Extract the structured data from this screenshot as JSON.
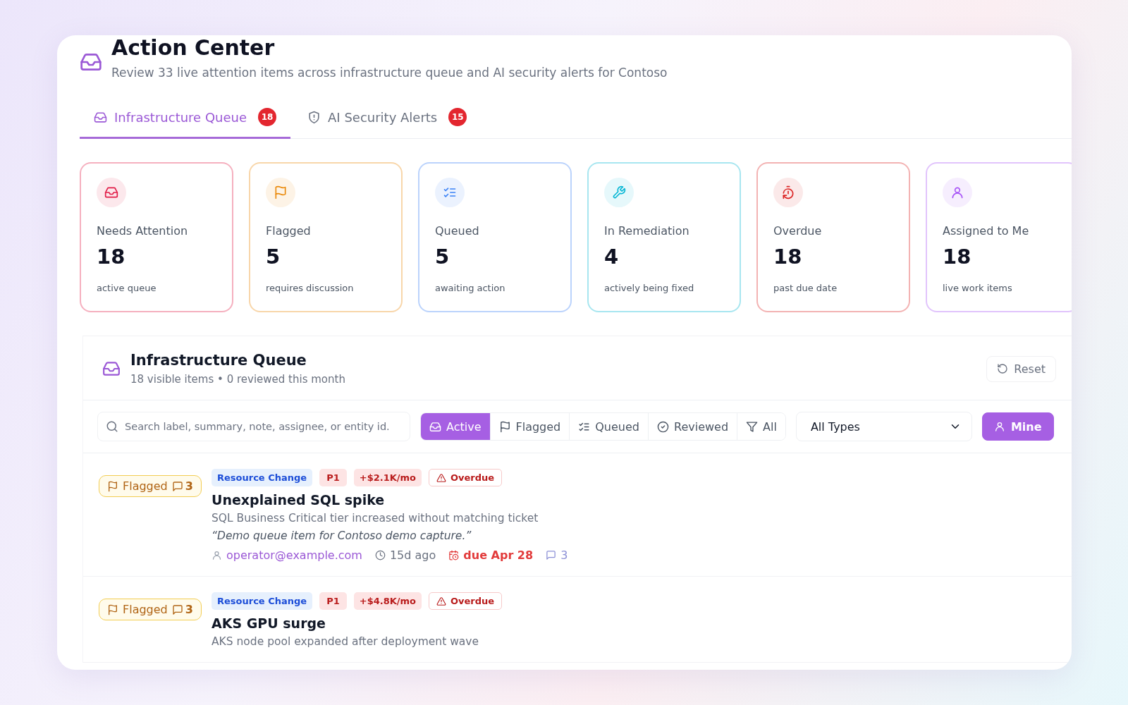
{
  "header": {
    "title": "Action Center",
    "subtitle": "Review 33 live attention items across infrastructure queue and AI security alerts for Contoso"
  },
  "tabs": [
    {
      "kind": "inbox",
      "label": "Infrastructure Queue",
      "count": "18",
      "selected": true
    },
    {
      "kind": "shield",
      "label": "AI Security Alerts",
      "count": "15",
      "selected": false
    }
  ],
  "stats": [
    {
      "kind": "inbox",
      "label": "Needs Attention",
      "value": "18",
      "note": "active queue",
      "color": "#e11d48"
    },
    {
      "kind": "flag",
      "label": "Flagged",
      "value": "5",
      "note": "requires discussion",
      "color": "#ea8a0c"
    },
    {
      "kind": "checklist",
      "label": "Queued",
      "value": "5",
      "note": "awaiting action",
      "color": "#3b82f6"
    },
    {
      "kind": "wrench",
      "label": "In Remediation",
      "value": "4",
      "note": "actively being fixed",
      "color": "#06b6d4"
    },
    {
      "kind": "timer",
      "label": "Overdue",
      "value": "18",
      "note": "past due date",
      "color": "#dc2626"
    },
    {
      "kind": "user",
      "label": "Assigned to Me",
      "value": "18",
      "note": "live work items",
      "color": "#a855f7"
    }
  ],
  "queue": {
    "title": "Infrastructure Queue",
    "summary": "18 visible items • 0 reviewed this month",
    "reset": "Reset",
    "search": {
      "placeholder": "Search label, summary, note, assignee, or entity id."
    },
    "filters": [
      {
        "kind": "inbox",
        "label": "Active",
        "selected": true
      },
      {
        "kind": "flag",
        "label": "Flagged",
        "selected": false
      },
      {
        "kind": "checklist",
        "label": "Queued",
        "selected": false
      },
      {
        "kind": "check",
        "label": "Reviewed",
        "selected": false
      },
      {
        "kind": "filter",
        "label": "All",
        "selected": false
      }
    ],
    "type_select": {
      "value": "All Types"
    },
    "mine": {
      "label": "Mine",
      "on": true
    },
    "items": [
      {
        "status": "Flagged",
        "status_comments": "3",
        "tags": [
          {
            "kind": "type",
            "label": "Resource Change"
          },
          {
            "kind": "priority",
            "label": "P1"
          },
          {
            "kind": "cost",
            "label": "+$2.1K/mo"
          },
          {
            "kind": "overdue",
            "label": "Overdue"
          }
        ],
        "title": "Unexplained SQL spike",
        "description": "SQL Business Critical tier increased without matching ticket",
        "note": "“Demo queue item for Contoso demo capture.”",
        "assignee": "operator@example.com",
        "age": "15d ago",
        "due": "due Apr 28",
        "comments": "3"
      },
      {
        "status": "Flagged",
        "status_comments": "3",
        "tags": [
          {
            "kind": "type",
            "label": "Resource Change"
          },
          {
            "kind": "priority",
            "label": "P1"
          },
          {
            "kind": "cost",
            "label": "+$4.8K/mo"
          },
          {
            "kind": "overdue",
            "label": "Overdue"
          }
        ],
        "title": "AKS GPU surge",
        "description": "AKS node pool expanded after deployment wave"
      }
    ]
  }
}
